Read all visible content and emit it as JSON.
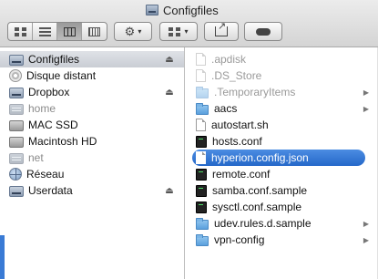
{
  "window": {
    "title": "Configfiles",
    "title_icon": "drive-icon"
  },
  "toolbar": {
    "view_buttons": [
      "icon-view",
      "list-view",
      "column-view",
      "cover-flow-view"
    ],
    "active_view": "column-view",
    "action_caret": "▾",
    "arrange_caret": "▾"
  },
  "sidebar": {
    "items": [
      {
        "label": "Configfiles",
        "icon": "drive-icon",
        "selected": true,
        "eject": "⏏",
        "greyed": false
      },
      {
        "label": "Disque distant",
        "icon": "disc-icon",
        "selected": false,
        "eject": "",
        "greyed": false
      },
      {
        "label": "Dropbox",
        "icon": "drive-icon",
        "selected": false,
        "eject": "⏏",
        "greyed": false
      },
      {
        "label": "home",
        "icon": "server-icon",
        "selected": false,
        "eject": "",
        "greyed": true
      },
      {
        "label": "MAC SSD",
        "icon": "mac-drive-icon",
        "selected": false,
        "eject": "",
        "greyed": false
      },
      {
        "label": "Macintosh HD",
        "icon": "mac-drive-icon",
        "selected": false,
        "eject": "",
        "greyed": false
      },
      {
        "label": "net",
        "icon": "server-icon",
        "selected": false,
        "eject": "",
        "greyed": true
      },
      {
        "label": "Réseau",
        "icon": "globe-icon",
        "selected": false,
        "eject": "",
        "greyed": false
      },
      {
        "label": "Userdata",
        "icon": "drive-icon",
        "selected": false,
        "eject": "⏏",
        "greyed": false
      }
    ]
  },
  "column": {
    "items": [
      {
        "label": ".apdisk",
        "icon": "document-icon",
        "hidden": true,
        "folder": false,
        "selected": false
      },
      {
        "label": ".DS_Store",
        "icon": "document-icon",
        "hidden": true,
        "folder": false,
        "selected": false
      },
      {
        "label": ".TemporaryItems",
        "icon": "folder-icon",
        "hidden": true,
        "folder": true,
        "selected": false
      },
      {
        "label": "aacs",
        "icon": "folder-icon",
        "hidden": false,
        "folder": true,
        "selected": false
      },
      {
        "label": "autostart.sh",
        "icon": "document-icon",
        "hidden": false,
        "folder": false,
        "selected": false
      },
      {
        "label": "hosts.conf",
        "icon": "executable-icon",
        "hidden": false,
        "folder": false,
        "selected": false
      },
      {
        "label": "hyperion.config.json",
        "icon": "document-icon",
        "hidden": false,
        "folder": false,
        "selected": true
      },
      {
        "label": "remote.conf",
        "icon": "executable-icon",
        "hidden": false,
        "folder": false,
        "selected": false
      },
      {
        "label": "samba.conf.sample",
        "icon": "executable-icon",
        "hidden": false,
        "folder": false,
        "selected": false
      },
      {
        "label": "sysctl.conf.sample",
        "icon": "executable-icon",
        "hidden": false,
        "folder": false,
        "selected": false
      },
      {
        "label": "udev.rules.d.sample",
        "icon": "folder-icon",
        "hidden": false,
        "folder": true,
        "selected": false
      },
      {
        "label": "vpn-config",
        "icon": "folder-icon",
        "hidden": false,
        "folder": true,
        "selected": false
      }
    ],
    "folder_arrow": "▶"
  },
  "colors": {
    "selection": "#2f6fcf",
    "sidebar_selection": "#d4d8de"
  }
}
